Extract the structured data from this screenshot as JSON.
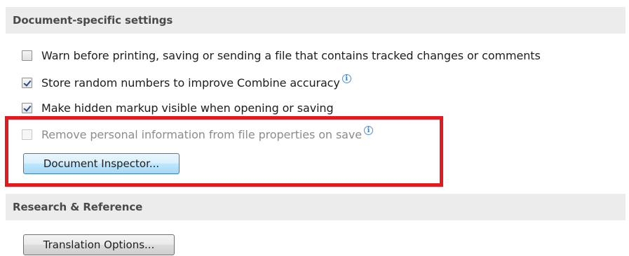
{
  "sections": {
    "document_specific": {
      "title": "Document-specific settings",
      "options": [
        {
          "label": "Warn before printing, saving or sending a file that contains tracked changes or comments",
          "checked": false,
          "disabled": false,
          "info": false
        },
        {
          "label": "Store random numbers to improve Combine accuracy",
          "checked": true,
          "disabled": false,
          "info": true
        },
        {
          "label": "Make hidden markup visible when opening or saving",
          "checked": true,
          "disabled": false,
          "info": false
        },
        {
          "label": "Remove personal information from file properties on save",
          "checked": false,
          "disabled": true,
          "info": true
        }
      ],
      "button_label": "Document Inspector..."
    },
    "research": {
      "title": "Research & Reference",
      "button_label": "Translation Options..."
    }
  },
  "info_icon_glyph": "i",
  "highlight_color": "#e3191f",
  "accent_button_color": "#bee6fd"
}
